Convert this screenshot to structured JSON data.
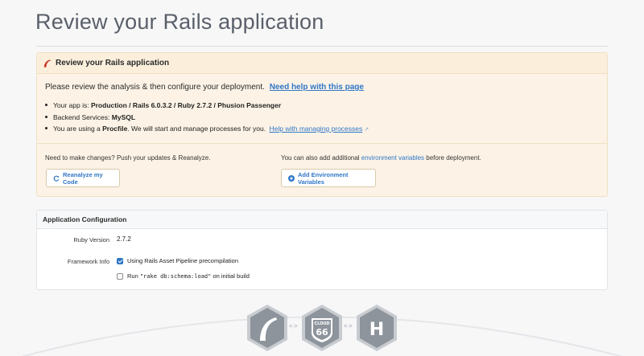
{
  "page": {
    "title": "Review your Rails application"
  },
  "review": {
    "header_title": "Review your Rails application",
    "intro_text": "Please review the analysis & then configure your deployment.",
    "help_link": "Need help with this page",
    "bullets": {
      "app_prefix": "Your app is: ",
      "app_value": "Production / Rails 6.0.3.2 / Ruby 2.7.2 / Phusion Passenger",
      "services_prefix": "Backend Services: ",
      "services_value": "MySQL",
      "procfile_prefix": "You are using a ",
      "procfile_bold": "Procfile",
      "procfile_suffix": ". We will start and manage processes for you.",
      "procfile_link": "Help with managing processes"
    },
    "push_text": "Need to make changes? Push your updates & Reanalyze.",
    "env_prefix": "You can also add additional ",
    "env_link": "environment variables",
    "env_suffix": " before deployment.",
    "reanalyze_button": "Reanalyze my Code",
    "env_button": "Add Environment Variables"
  },
  "config": {
    "header": "Application Configuration",
    "ruby_label": "Ruby Version",
    "ruby_value": "2.7.2",
    "framework_label": "Framework Info",
    "option1": {
      "label": "Using Rails Asset Pipeline precompilation",
      "checked": true
    },
    "option2": {
      "prefix": "Run ",
      "code": "\"rake db:schema:load\"",
      "suffix": " on initial build",
      "checked": false
    }
  },
  "flow": {
    "cloud_badge_top": "CLOUD",
    "cloud_badge_num": "66",
    "server_letter": "H",
    "link_glyph": "<·>"
  },
  "colors": {
    "accent": "#2f76c7",
    "warning_bg": "#fcf3e6",
    "hex_fill": "#8e949c"
  },
  "icons": [
    "rails-icon",
    "external-link-icon",
    "refresh-icon",
    "plus-circle-icon",
    "checkbox-icon",
    "hexagon-icon"
  ]
}
